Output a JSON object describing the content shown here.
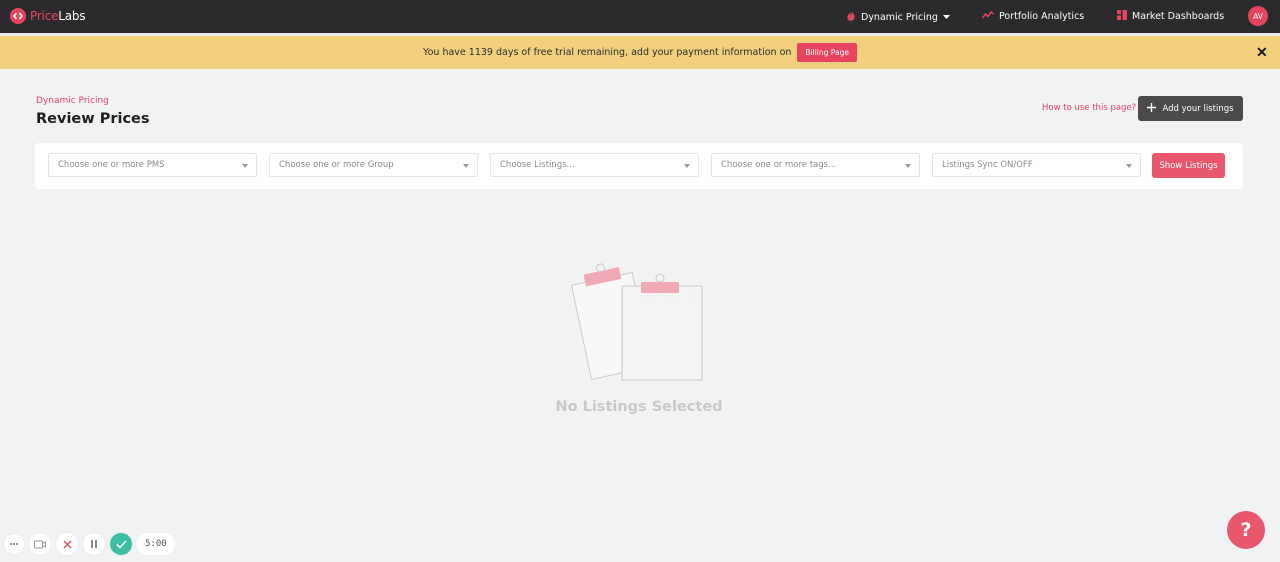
{
  "brand": {
    "name_part1": "Price",
    "name_part2": "Labs"
  },
  "nav": {
    "items": [
      {
        "label": "Dynamic Pricing",
        "icon": "flame-icon",
        "has_dropdown": true
      },
      {
        "label": "Portfolio Analytics",
        "icon": "trend-icon"
      },
      {
        "label": "Market Dashboards",
        "icon": "grid-icon"
      }
    ],
    "avatar_initials": "AV"
  },
  "banner": {
    "text": "You have 1139 days of free trial remaining, add your payment information on",
    "button_label": "Billing Page",
    "close_label": "✕"
  },
  "header": {
    "breadcrumb": "Dynamic Pricing",
    "title": "Review Prices",
    "howto_link": "How to use this page?",
    "add_button_label": "Add your listings"
  },
  "filters": {
    "pms_placeholder": "Choose one or more PMS",
    "group_placeholder": "Choose one or more Group",
    "listings_placeholder": "Choose Listings...",
    "tags_placeholder": "Choose one or more tags...",
    "sync_placeholder": "Listings Sync ON/OFF",
    "show_button_label": "Show Listings"
  },
  "empty_state": {
    "text": "No Listings Selected"
  },
  "recorder": {
    "time": "5:00"
  },
  "help": {
    "label": "?"
  },
  "colors": {
    "accent": "#e8445f",
    "nav_bg": "#2b2b2d",
    "banner_bg": "#f2d07e",
    "page_bg": "#f1f2f4",
    "dark_button": "#4a4a4c",
    "check": "#3dbfa5"
  }
}
